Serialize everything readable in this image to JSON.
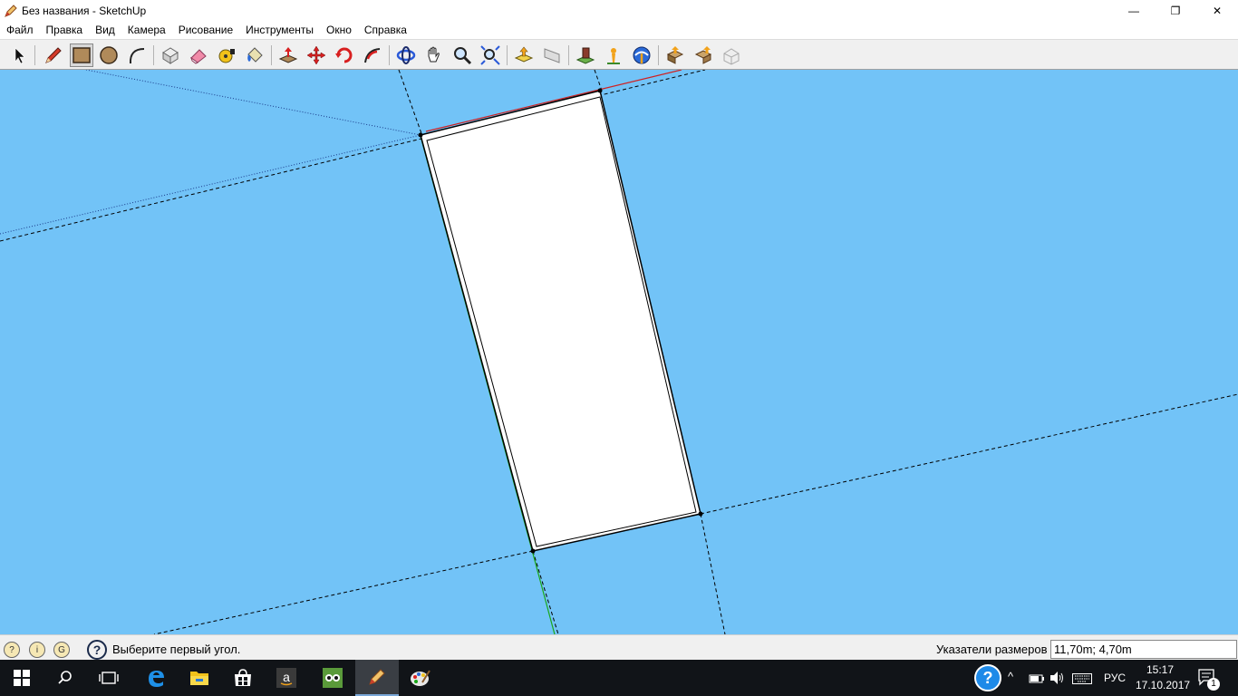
{
  "window": {
    "title": "Без названия - SketchUp",
    "controls": {
      "minimize": "—",
      "restore": "❐",
      "close": "✕"
    }
  },
  "menu": [
    "Файл",
    "Правка",
    "Вид",
    "Камера",
    "Рисование",
    "Инструменты",
    "Окно",
    "Справка"
  ],
  "toolbar": {
    "tools": [
      "select-tool-icon",
      "pencil-tool-icon",
      "rectangle-tool-icon",
      "circle-tool-icon",
      "arc-tool-icon",
      "make-component-icon",
      "eraser-tool-icon",
      "tape-measure-icon",
      "paint-bucket-icon",
      "push-pull-icon",
      "move-tool-icon",
      "rotate-tool-icon",
      "follow-me-icon",
      "orbit-tool-icon",
      "pan-tool-icon",
      "zoom-tool-icon",
      "zoom-extents-icon",
      "previous-view-icon",
      "next-view-icon",
      "add-location-icon",
      "toggle-terrain-icon",
      "get-models-icon",
      "share-model-icon",
      "share-component-icon",
      "extension-warehouse-icon"
    ],
    "active": "rectangle-tool-icon"
  },
  "status": {
    "message": "Выберите первый угол.",
    "measure_label": "Указатели размеров",
    "measure_value": "11,70m; 4,70m"
  },
  "taskbar": {
    "apps": [
      "start-icon",
      "search-icon",
      "task-view-icon",
      "edge-icon",
      "file-explorer-icon",
      "store-icon",
      "amazon-icon",
      "tripadvisor-icon",
      "sketchup-icon",
      "paint-icon"
    ],
    "active": "sketchup-icon",
    "language": "РУС",
    "time": "15:17",
    "date": "17.10.2017",
    "notification_count": "1"
  },
  "colors": {
    "sky": "#72c3f7",
    "face": "#ffffff",
    "red_axis": "#d02020",
    "green_axis": "#1aa81a"
  }
}
